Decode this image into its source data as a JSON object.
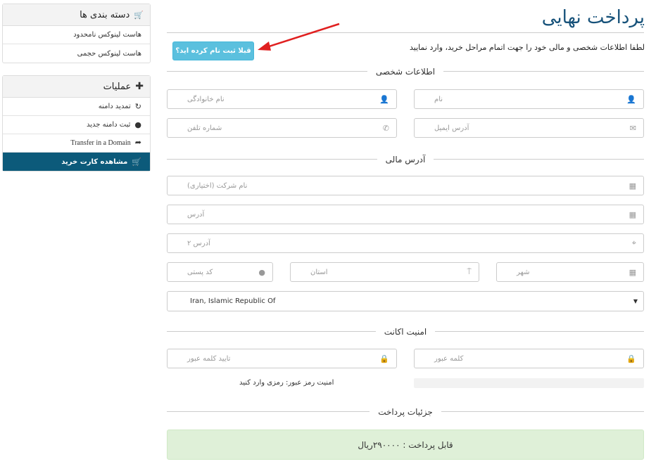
{
  "sidebar": {
    "categories": {
      "title": "دسته بندی ها",
      "icon": "cart-icon",
      "items": [
        {
          "label": "هاست لینوکس نامحدود"
        },
        {
          "label": "هاست لینوکس حجمی"
        }
      ]
    },
    "actions": {
      "title": "عملیات",
      "icon": "plus-icon",
      "items": [
        {
          "label": "تمدید دامنه",
          "icon": "refresh-icon"
        },
        {
          "label": "ثبت دامنه جدید",
          "icon": "globe-icon"
        },
        {
          "label": "Transfer in a Domain",
          "icon": "share-icon"
        },
        {
          "label": "مشاهده کارت خرید",
          "icon": "cart-icon",
          "active": true
        }
      ]
    }
  },
  "page": {
    "title": "پرداخت نهایی",
    "intro": "لطفا اطلاعات شخصی و مالی خود را جهت اتمام مراحل خرید، وارد نمایید",
    "login_button": "قبلا ثبت نام کرده اید؟"
  },
  "personal": {
    "legend": "اطلاعات شخصی",
    "first_name": "نام",
    "last_name": "نام خانوادگی",
    "email": "آدرس ایمیل",
    "phone": "شماره تلفن"
  },
  "billing": {
    "legend": "آدرس مالی",
    "company": "نام شرکت (اختیاری)",
    "address1": "آدرس",
    "address2": "آدرس ۲",
    "city": "شهر",
    "state": "استان",
    "postcode": "کد پستی",
    "country_selected": "Iran, Islamic Republic Of"
  },
  "security": {
    "legend": "امنیت اکانت",
    "password": "کلمه عبور",
    "confirm_password": "تایید کلمه عبور",
    "strength_text": "امنیت رمز عبور: رمزی وارد کنید"
  },
  "payment": {
    "legend": "جزئیات پرداخت",
    "total": "قابل پرداخت : ۲۹۰۰۰۰ریال"
  },
  "colors": {
    "accent": "#17527a",
    "active_nav": "#0c5a7a",
    "info_button": "#5bc0de",
    "success_bg": "#dff0d8",
    "arrow": "#e02020"
  }
}
